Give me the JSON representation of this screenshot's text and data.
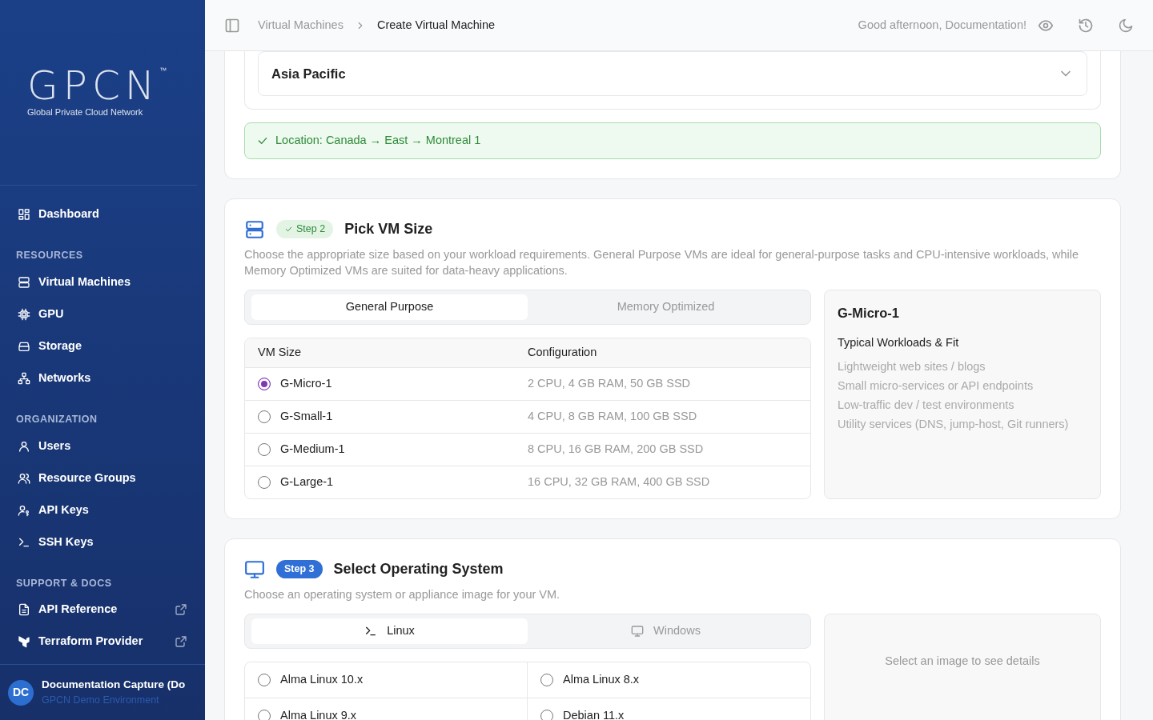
{
  "sidebar": {
    "logo": "GPCN",
    "trademark": "™",
    "tagline": "Global Private Cloud Network",
    "sections": [
      {
        "items": [
          {
            "label": "Dashboard"
          }
        ]
      },
      {
        "heading": "RESOURCES",
        "items": [
          {
            "label": "Virtual Machines"
          },
          {
            "label": "GPU"
          },
          {
            "label": "Storage"
          },
          {
            "label": "Networks"
          }
        ]
      },
      {
        "heading": "ORGANIZATION",
        "items": [
          {
            "label": "Users"
          },
          {
            "label": "Resource Groups"
          },
          {
            "label": "API Keys"
          },
          {
            "label": "SSH Keys"
          }
        ]
      },
      {
        "heading": "SUPPORT & DOCS",
        "items": [
          {
            "label": "API Reference"
          },
          {
            "label": "Terraform Provider"
          }
        ]
      }
    ],
    "user": {
      "initials": "DC",
      "name": "Documentation Capture (Do",
      "org": "GPCN Demo Environment"
    }
  },
  "topbar": {
    "breadcrumb": [
      "Virtual Machines",
      "Create Virtual Machine"
    ],
    "greeting": "Good afternoon, Documentation!"
  },
  "location_card": {
    "region": "Asia Pacific",
    "notice": "Location: Canada → East → Montreal 1"
  },
  "size_card": {
    "step": "Step 2",
    "step_done": true,
    "title": "Pick VM Size",
    "description": "Choose the appropriate size based on your workload requirements. General Purpose VMs are ideal for general-purpose tasks and CPU-intensive workloads, while Memory Optimized VMs are suited for data-heavy applications.",
    "tabs": [
      {
        "label": "General Purpose",
        "selected": true
      },
      {
        "label": "Memory Optimized",
        "selected": false
      }
    ],
    "columns": [
      "VM Size",
      "Configuration"
    ],
    "rows": [
      {
        "name": "G-Micro-1",
        "config": "2 CPU, 4 GB RAM, 50 GB SSD",
        "selected": true
      },
      {
        "name": "G-Small-1",
        "config": "4 CPU, 8 GB RAM, 100 GB SSD",
        "selected": false
      },
      {
        "name": "G-Medium-1",
        "config": "8 CPU, 16 GB RAM, 200 GB SSD",
        "selected": false
      },
      {
        "name": "G-Large-1",
        "config": "16 CPU, 32 GB RAM, 400 GB SSD",
        "selected": false
      }
    ],
    "details": {
      "title": "G-Micro-1",
      "subtitle": "Typical Workloads & Fit",
      "items": [
        "Lightweight web sites / blogs",
        "Small micro-services or API endpoints",
        "Low-traffic dev / test environments",
        "Utility services (DNS, jump-host, Git runners)"
      ]
    }
  },
  "os_card": {
    "step": "Step 3",
    "step_done": false,
    "title": "Select Operating System",
    "description": "Choose an operating system or appliance image for your VM.",
    "tabs": [
      {
        "label": "Linux",
        "selected": true
      },
      {
        "label": "Windows",
        "selected": false
      }
    ],
    "images": [
      {
        "name": "Alma Linux 10.x",
        "selected": false
      },
      {
        "name": "Alma Linux 8.x",
        "selected": false
      },
      {
        "name": "Alma Linux 9.x",
        "selected": false
      },
      {
        "name": "Debian 11.x",
        "selected": false
      }
    ],
    "details_placeholder": "Select an image to see details"
  }
}
